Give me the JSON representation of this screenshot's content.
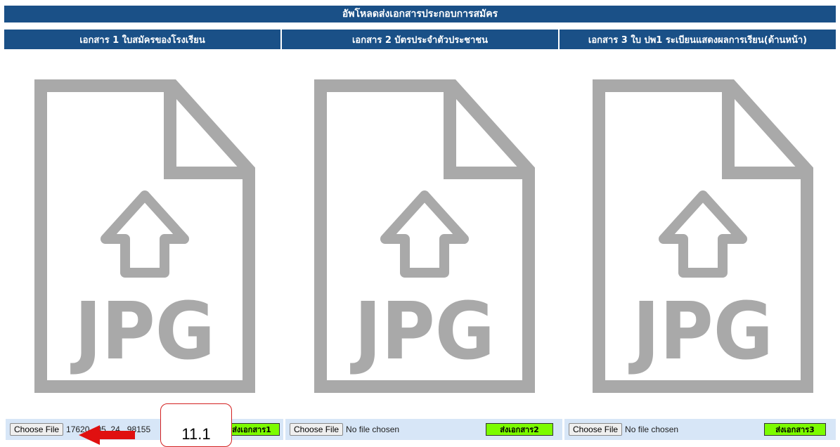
{
  "page": {
    "title": "อัพโหลดส่งเอกสารประกอบการสมัคร"
  },
  "columns": [
    {
      "header": "เอกสาร 1 ใบสมัครของโรงเรียน",
      "icon_label": "JPG",
      "choose_label": "Choose File",
      "file_status": "17620...05_24...98155",
      "send_label": "ส่งเอกสาร1"
    },
    {
      "header": "เอกสาร 2 บัตรประจำตัวประชาชน",
      "icon_label": "JPG",
      "choose_label": "Choose File",
      "file_status": "No file chosen",
      "send_label": "ส่งเอกสาร2"
    },
    {
      "header": "เอกสาร 3 ใบ ปพ1 ระเบียนแสดงผลการเรียน(ด้านหน้า)",
      "icon_label": "JPG",
      "choose_label": "Choose File",
      "file_status": "No file chosen",
      "send_label": "ส่งเอกสาร3"
    }
  ],
  "annotation": {
    "callout_text": "11.1",
    "arrow_color": "#e01010",
    "icon": "arrow-left-icon"
  },
  "colors": {
    "header_bg": "#1a5087",
    "file_bar_bg": "#d7e6f7",
    "send_button_bg": "#7cfc00",
    "icon_gray": "#a9a9a9"
  }
}
